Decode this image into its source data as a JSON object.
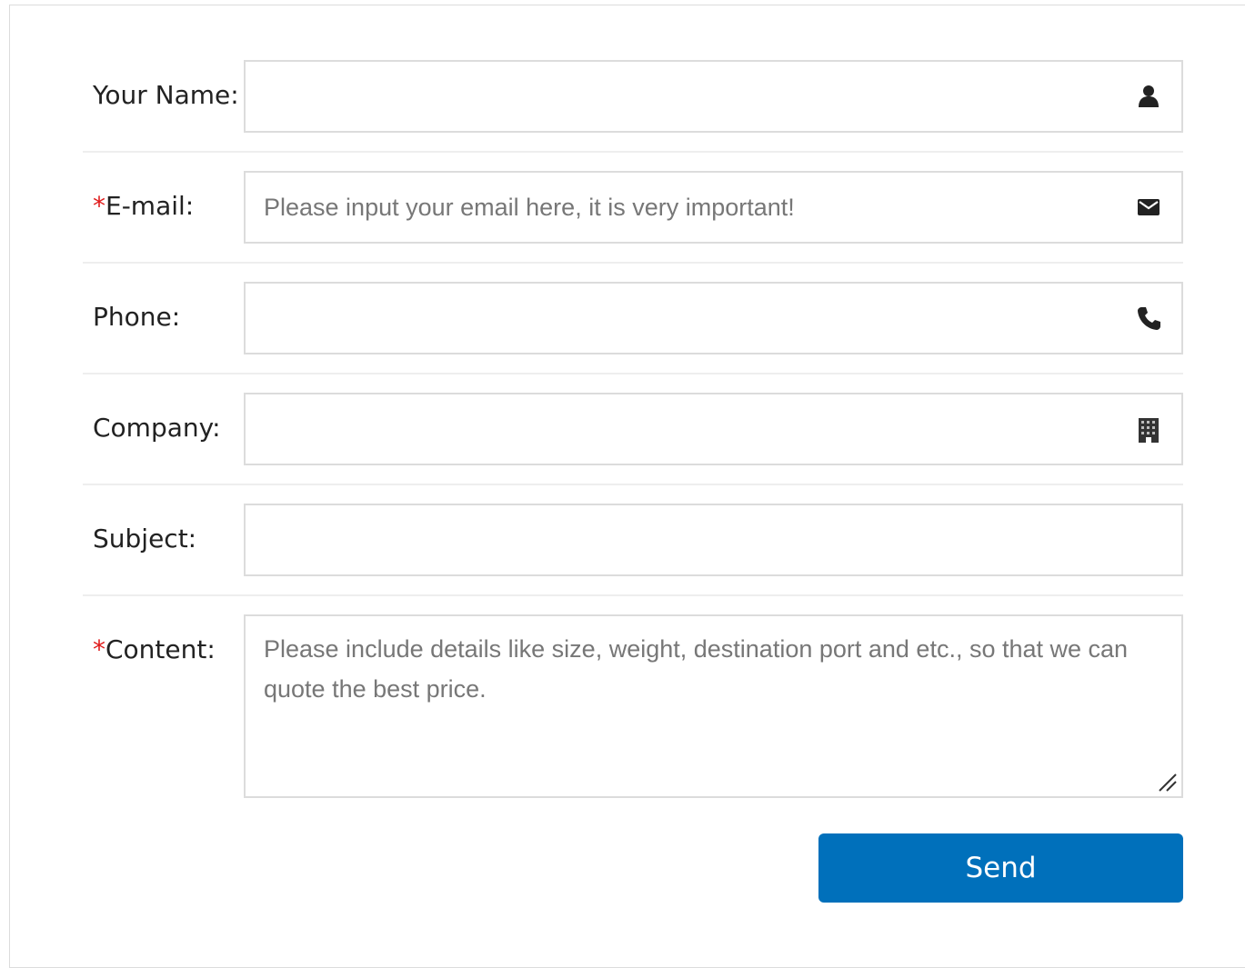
{
  "form": {
    "fields": [
      {
        "label": "Your Name:",
        "required": false,
        "placeholder": "",
        "icon": "user-icon"
      },
      {
        "label": "E-mail:",
        "required": true,
        "placeholder": "Please input your email here, it is very important!",
        "icon": "envelope-icon"
      },
      {
        "label": "Phone:",
        "required": false,
        "placeholder": "",
        "icon": "phone-icon"
      },
      {
        "label": "Company:",
        "required": false,
        "placeholder": "",
        "icon": "building-icon"
      },
      {
        "label": "Subject:",
        "required": false,
        "placeholder": "",
        "icon": ""
      },
      {
        "label": "Content:",
        "required": true,
        "placeholder": "Please include details like size, weight, destination port and etc., so that we can quote the best price.",
        "icon": "resize-grip-icon"
      }
    ],
    "required_marker": "*",
    "send_label": "Send"
  },
  "colors": {
    "accent": "#0070bb",
    "required": "#e01b1b",
    "border": "#dcdcdc"
  }
}
